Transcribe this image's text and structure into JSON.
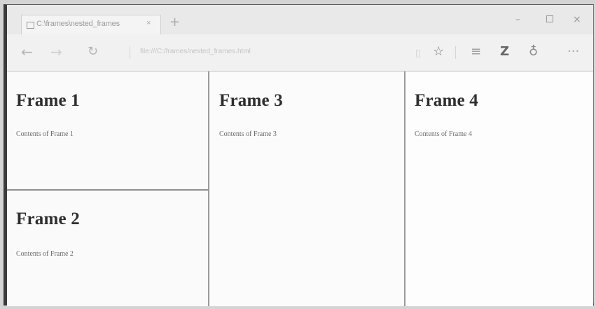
{
  "browser": {
    "tab": {
      "title": "C:\\frames\\nested_frames",
      "close": "×",
      "new_tab": "+"
    },
    "window_controls": {
      "minimize": "–",
      "maximize": "□",
      "close": "×"
    },
    "nav": {
      "back": "←",
      "forward": "→",
      "refresh": "↻"
    },
    "address": {
      "url": "file:///C:/frames/nested_frames.html"
    },
    "toolbar": {
      "reading_view": "▯",
      "favorite": "☆",
      "hub": "≡",
      "web_note": "Z",
      "share": "♁",
      "more": "···"
    }
  },
  "frames": [
    {
      "heading": "Frame 1",
      "text": "Contents of Frame 1"
    },
    {
      "heading": "Frame 2",
      "text": "Contents of Frame 2"
    },
    {
      "heading": "Frame 3",
      "text": "Contents of Frame 3"
    },
    {
      "heading": "Frame 4",
      "text": "Contents of Frame 4"
    }
  ]
}
